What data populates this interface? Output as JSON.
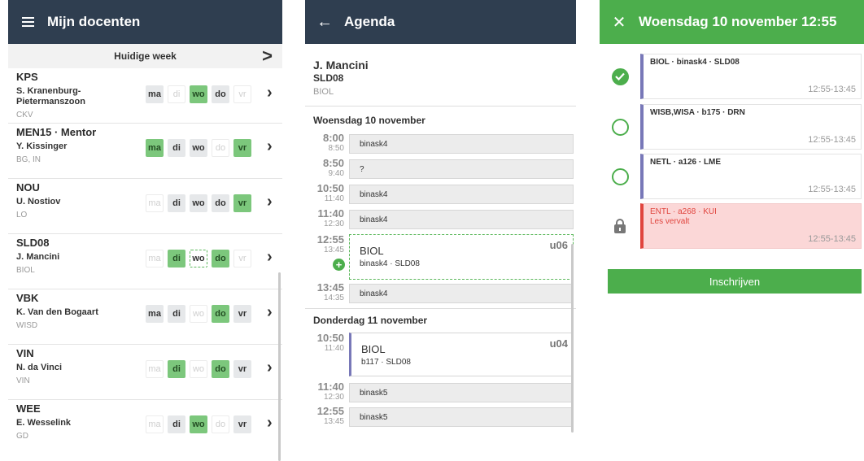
{
  "docenten": {
    "title": "Mijn docenten",
    "week_label": "Huidige week",
    "next_glyph": ">",
    "teachers": [
      {
        "code": "KPS",
        "name": "S. Kranenburg-Pietermanszoon",
        "subject": "CKV",
        "days": [
          {
            "label": "ma",
            "state": "grey"
          },
          {
            "label": "di",
            "state": "off"
          },
          {
            "label": "wo",
            "state": "green"
          },
          {
            "label": "do",
            "state": "grey"
          },
          {
            "label": "vr",
            "state": "off"
          }
        ]
      },
      {
        "code": "MEN15 · Mentor",
        "name": "Y. Kissinger",
        "subject": "BG, IN",
        "days": [
          {
            "label": "ma",
            "state": "green"
          },
          {
            "label": "di",
            "state": "grey"
          },
          {
            "label": "wo",
            "state": "grey"
          },
          {
            "label": "do",
            "state": "off"
          },
          {
            "label": "vr",
            "state": "green"
          }
        ]
      },
      {
        "code": "NOU",
        "name": "U. Nostiov",
        "subject": "LO",
        "days": [
          {
            "label": "ma",
            "state": "off"
          },
          {
            "label": "di",
            "state": "grey"
          },
          {
            "label": "wo",
            "state": "grey"
          },
          {
            "label": "do",
            "state": "grey"
          },
          {
            "label": "vr",
            "state": "green"
          }
        ]
      },
      {
        "code": "SLD08",
        "name": "J. Mancini",
        "subject": "BIOL",
        "days": [
          {
            "label": "ma",
            "state": "off"
          },
          {
            "label": "di",
            "state": "green"
          },
          {
            "label": "wo",
            "state": "sel"
          },
          {
            "label": "do",
            "state": "green"
          },
          {
            "label": "vr",
            "state": "off"
          }
        ]
      },
      {
        "code": "VBK",
        "name": "K. Van den Bogaart",
        "subject": "WISD",
        "days": [
          {
            "label": "ma",
            "state": "grey"
          },
          {
            "label": "di",
            "state": "grey"
          },
          {
            "label": "wo",
            "state": "off"
          },
          {
            "label": "do",
            "state": "green"
          },
          {
            "label": "vr",
            "state": "grey"
          }
        ]
      },
      {
        "code": "VIN",
        "name": "N. da Vinci",
        "subject": "VIN",
        "days": [
          {
            "label": "ma",
            "state": "off"
          },
          {
            "label": "di",
            "state": "green"
          },
          {
            "label": "wo",
            "state": "off"
          },
          {
            "label": "do",
            "state": "green"
          },
          {
            "label": "vr",
            "state": "grey"
          }
        ]
      },
      {
        "code": "WEE",
        "name": "E. Wesselink",
        "subject": "GD",
        "days": [
          {
            "label": "ma",
            "state": "off"
          },
          {
            "label": "di",
            "state": "grey"
          },
          {
            "label": "wo",
            "state": "green"
          },
          {
            "label": "do",
            "state": "off"
          },
          {
            "label": "vr",
            "state": "grey"
          }
        ]
      }
    ]
  },
  "agenda": {
    "title": "Agenda",
    "back_glyph": "←",
    "teacher_name": "J. Mancini",
    "teacher_code": "SLD08",
    "teacher_subject": "BIOL",
    "day1": {
      "header": "Woensdag 10 november",
      "slots": [
        {
          "start": "8:00",
          "end": "8:50",
          "text": "binask4"
        },
        {
          "start": "8:50",
          "end": "9:40",
          "text": "?"
        },
        {
          "start": "10:50",
          "end": "11:40",
          "text": "binask4"
        },
        {
          "start": "11:40",
          "end": "12:30",
          "text": "binask4"
        }
      ],
      "lesson": {
        "start": "12:55",
        "end": "13:45",
        "subject": "BIOL",
        "detail": "binask4 · SLD08",
        "room": "u06"
      },
      "last": {
        "start": "13:45",
        "end": "14:35",
        "text": "binask4"
      }
    },
    "day2": {
      "header": "Donderdag 11 november",
      "lesson": {
        "start": "10:50",
        "end": "11:40",
        "subject": "BIOL",
        "detail": "b117 · SLD08",
        "room": "u04"
      },
      "slots": [
        {
          "start": "11:40",
          "end": "12:30",
          "text": "binask5"
        },
        {
          "start": "12:55",
          "end": "13:45",
          "text": "binask5"
        }
      ]
    }
  },
  "keuze": {
    "title": "Woensdag 10 november 12:55",
    "close_glyph": "✕",
    "options": [
      {
        "title": "BIOL · binask4 · SLD08",
        "sub": "",
        "time": "12:55-13:45",
        "state": "checked"
      },
      {
        "title": "WISB,WISA · b175 · DRN",
        "sub": "",
        "time": "12:55-13:45",
        "state": "open"
      },
      {
        "title": "NETL · a126 · LME",
        "sub": "",
        "time": "12:55-13:45",
        "state": "open"
      },
      {
        "title": "ENTL · a268 · KUI",
        "sub": "Les vervalt",
        "time": "12:55-13:45",
        "state": "locked"
      }
    ],
    "button": "Inschrijven"
  },
  "colors": {
    "header_dark": "#2f3e50",
    "header_green": "#4cae4c",
    "day_green": "#7cc77c",
    "lesson_stripe": "#7878b8",
    "cancelled_red": "#e0453e"
  }
}
